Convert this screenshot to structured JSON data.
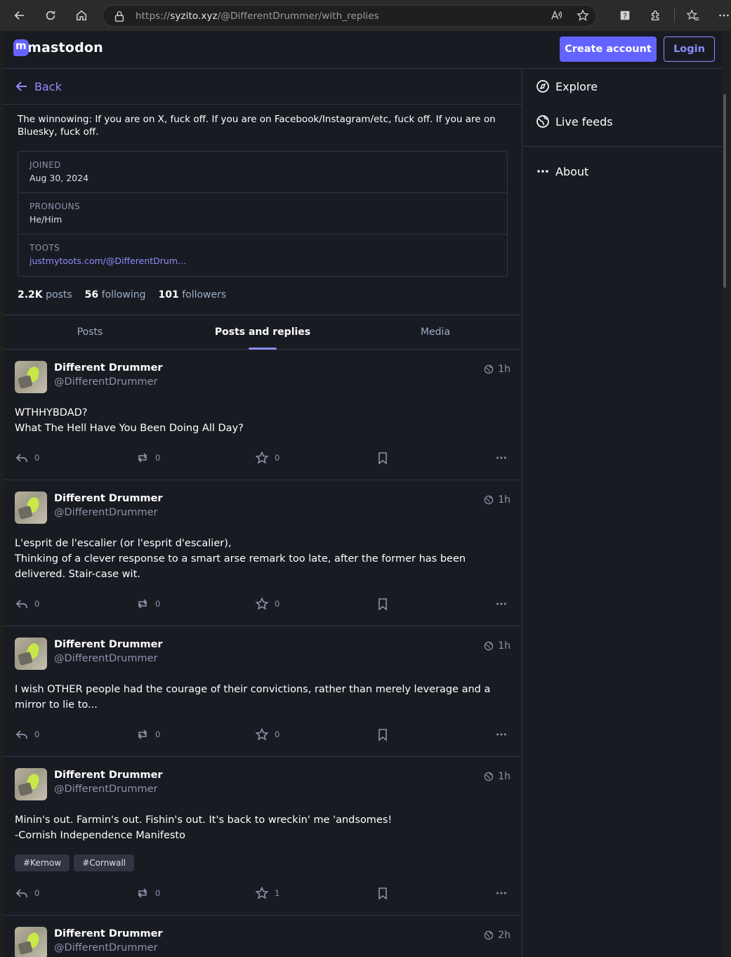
{
  "browser": {
    "url_scheme": "https://",
    "url_host": "syzito.xyz",
    "url_path": "/@DifferentDrummer/with_replies"
  },
  "brand": {
    "name": "mastodon",
    "accent": "#6364ff",
    "link": "#8c8dff"
  },
  "topbar": {
    "create_account": "Create account",
    "login": "Login"
  },
  "nav": {
    "back": "Back"
  },
  "profile": {
    "bio": "The winnowing: If you are on X, fuck off. If you are on Facebook/Instagram/etc, fuck off. If you are on Bluesky, fuck off.",
    "fields": [
      {
        "key": "JOINED",
        "value": "Aug 30, 2024"
      },
      {
        "key": "PRONOUNS",
        "value": "He/Him"
      },
      {
        "key": "TOOTS",
        "value": "justmytoots.com/@DifferentDrum…"
      }
    ],
    "posts_count": "2.2K",
    "posts_label": "posts",
    "following_count": "56",
    "following_label": "following",
    "followers_count": "101",
    "followers_label": "followers"
  },
  "tabs": [
    "Posts",
    "Posts and replies",
    "Media"
  ],
  "statuses": [
    {
      "display_name": "Different Drummer",
      "acct": "@DifferentDrummer",
      "time": "1h",
      "lines": [
        "WTHHYBDAD?",
        "What The Hell Have You Been Doing All Day?"
      ],
      "hashtags": [],
      "replies": "0",
      "boosts": "0",
      "favs": "0"
    },
    {
      "display_name": "Different Drummer",
      "acct": "@DifferentDrummer",
      "time": "1h",
      "lines": [
        "L'esprit de l'escalier (or l'esprit d'escalier),",
        "Thinking of a clever response to a smart arse remark too late, after the former has been delivered. Stair-case wit."
      ],
      "hashtags": [],
      "replies": "0",
      "boosts": "0",
      "favs": "0"
    },
    {
      "display_name": "Different Drummer",
      "acct": "@DifferentDrummer",
      "time": "1h",
      "lines": [
        "I wish OTHER people had the courage of their convictions, rather than merely leverage and a mirror to lie to..."
      ],
      "hashtags": [],
      "replies": "0",
      "boosts": "0",
      "favs": "0"
    },
    {
      "display_name": "Different Drummer",
      "acct": "@DifferentDrummer",
      "time": "1h",
      "lines": [
        "Minin's out. Farmin's out. Fishin's out. It's back to wreckin' me 'andsomes!",
        "-Cornish Independence Manifesto"
      ],
      "hashtags": [
        "#Kernow",
        "#Cornwall"
      ],
      "replies": "0",
      "boosts": "0",
      "favs": "1"
    },
    {
      "display_name": "Different Drummer",
      "acct": "@DifferentDrummer",
      "time": "2h",
      "lines": [],
      "hashtags": [],
      "replies": "",
      "boosts": "",
      "favs": ""
    }
  ],
  "sidebar": {
    "explore": "Explore",
    "live_feeds": "Live feeds",
    "about": "About"
  }
}
